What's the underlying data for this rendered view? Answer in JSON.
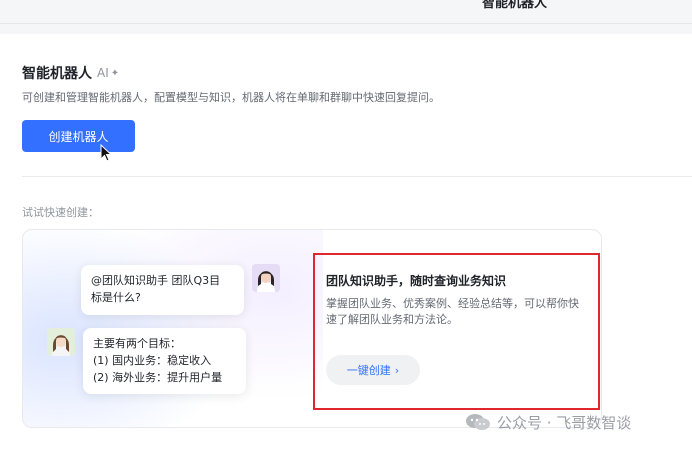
{
  "topbar": {
    "title": "智能机器人"
  },
  "header": {
    "title": "智能机器人",
    "ai_tag": "AI",
    "ai_star": "✦",
    "description": "可创建和管理智能机器人，配置模型与知识，机器人将在单聊和群聊中快速回复提问。",
    "create_button": "创建机器人"
  },
  "quick_create": {
    "label": "试试快速创建：",
    "card": {
      "question_lines": [
        "@团队知识助手 团队Q3目",
        "标是什么?"
      ],
      "answer_lines": [
        "主要有两个目标：",
        "(1) 国内业务：稳定收入",
        "(2) 海外业务：提升用户量"
      ],
      "title": "团队知识助手，随时查询业务知识",
      "description": "掌握团队业务、优秀案例、经验总结等，可以帮你快速了解团队业务和方法论。",
      "action_label": "一键创建",
      "action_chevron": "›"
    }
  },
  "watermark": {
    "text": "公众号 · 飞哥数智谈"
  },
  "colors": {
    "primary": "#3370ff",
    "highlight_border": "#e0262f"
  }
}
